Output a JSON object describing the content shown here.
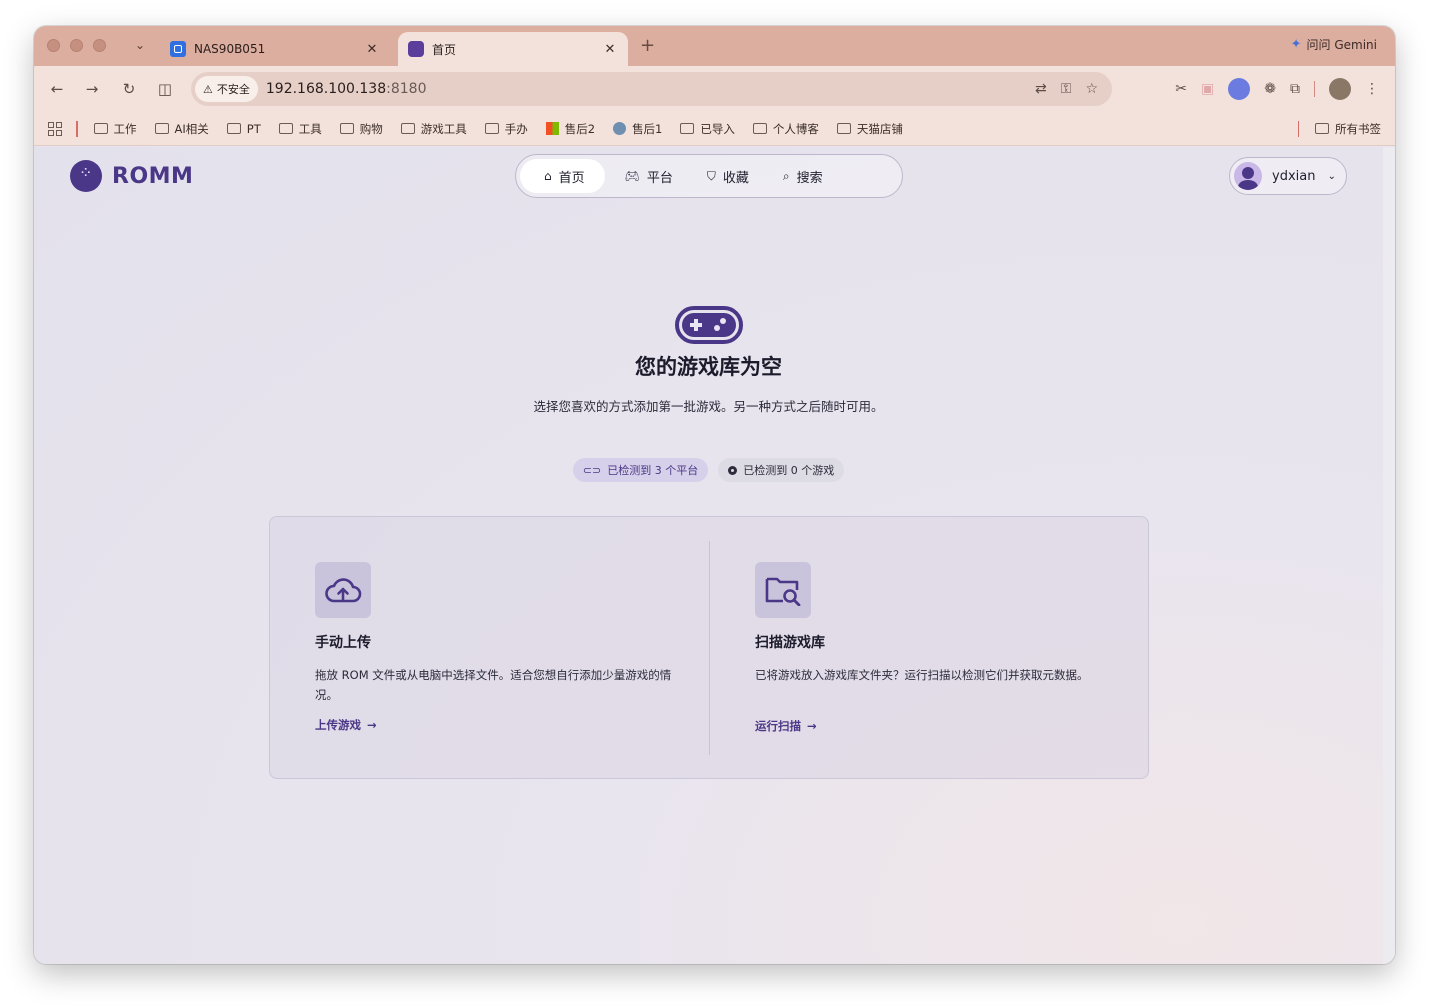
{
  "browser": {
    "tabs": [
      {
        "title": "NAS90B051",
        "active": false
      },
      {
        "title": "首页",
        "active": true
      }
    ],
    "gemini_label": "问问 Gemini",
    "security_label": "不安全",
    "url_host": "192.168.100.138",
    "url_port": ":8180",
    "bookmarks": [
      {
        "label": "工作"
      },
      {
        "label": "AI相关"
      },
      {
        "label": "PT"
      },
      {
        "label": "工具"
      },
      {
        "label": "购物"
      },
      {
        "label": "游戏工具"
      },
      {
        "label": "手办"
      },
      {
        "label": "售后2"
      },
      {
        "label": "售后1"
      },
      {
        "label": "已导入"
      },
      {
        "label": "个人博客"
      },
      {
        "label": "天猫店铺"
      }
    ],
    "all_bookmarks_label": "所有书签"
  },
  "app": {
    "logo_text": "ROMM",
    "nav": [
      {
        "label": "首页",
        "icon": "home-icon",
        "active": true
      },
      {
        "label": "平台",
        "icon": "gamepad-icon",
        "active": false
      },
      {
        "label": "收藏",
        "icon": "bookmark-icon",
        "active": false
      },
      {
        "label": "搜索",
        "icon": "search-icon",
        "active": false
      }
    ],
    "user": {
      "name": "ydxian"
    },
    "empty_state": {
      "title": "您的游戏库为空",
      "subtitle": "选择您喜欢的方式添加第一批游戏。另一种方式之后随时可用。",
      "chip_platforms": "已检测到 3 个平台",
      "chip_games": "已检测到 0 个游戏"
    },
    "cards": {
      "upload": {
        "title": "手动上传",
        "description": "拖放 ROM 文件或从电脑中选择文件。适合您想自行添加少量游戏的情况。",
        "link": "上传游戏"
      },
      "scan": {
        "title": "扫描游戏库",
        "description": "已将游戏放入游戏库文件夹？运行扫描以检测它们并获取元数据。",
        "link": "运行扫描"
      }
    }
  },
  "colors": {
    "accent": "#4b3787",
    "tabstrip": "#dcae9f",
    "toolbar": "#f3e2db",
    "page_bg": "#e3e1ec"
  }
}
